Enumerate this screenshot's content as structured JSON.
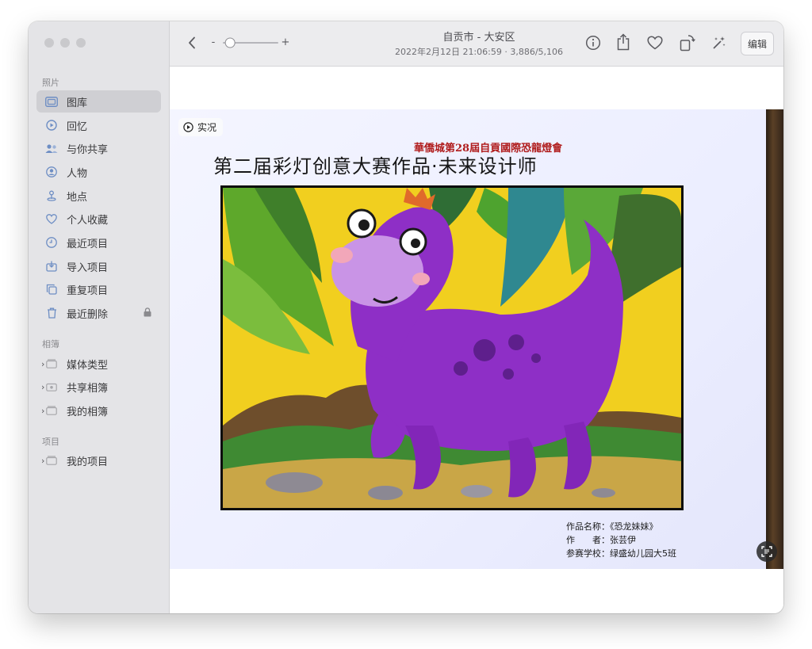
{
  "sidebar": {
    "sections": [
      {
        "label": "照片"
      },
      {
        "label": "相簿"
      },
      {
        "label": "项目"
      }
    ],
    "photos_items": [
      {
        "label": "图库",
        "icon": "photo-library-icon"
      },
      {
        "label": "回忆",
        "icon": "memories-icon"
      },
      {
        "label": "与你共享",
        "icon": "shared-with-you-icon"
      },
      {
        "label": "人物",
        "icon": "people-icon"
      },
      {
        "label": "地点",
        "icon": "places-icon"
      },
      {
        "label": "个人收藏",
        "icon": "heart-icon"
      },
      {
        "label": "最近项目",
        "icon": "clock-icon"
      },
      {
        "label": "导入项目",
        "icon": "import-icon"
      },
      {
        "label": "重复项目",
        "icon": "duplicates-icon"
      },
      {
        "label": "最近删除",
        "icon": "trash-icon"
      }
    ],
    "album_groups": [
      {
        "label": "媒体类型"
      },
      {
        "label": "共享相簿"
      },
      {
        "label": "我的相簿"
      }
    ],
    "project_groups": [
      {
        "label": "我的项目"
      }
    ]
  },
  "toolbar": {
    "title": "自贡市 - 大安区",
    "subtitle": "2022年2月12日 21:06:59  ·  3,886/5,106",
    "zoom_minus": "-",
    "zoom_plus": "+",
    "zoom_level": 0.12,
    "edit_label": "编辑"
  },
  "photo": {
    "live_label": "实况",
    "red_title": "華僑城第28屆自貢國際恐龍燈會",
    "main_title": "第二届彩灯创意大赛作品·未来设计师",
    "caption": [
      "作品名称：《恐龙妹妹》",
      "作　　者：张芸伊",
      "参赛学校：绿盛幼儿园大5班"
    ]
  },
  "colors": {
    "sidebar_bg": "#e4e4e7",
    "selected_bg": "#cfcfd3",
    "accent_icon": "#6e8ec4",
    "dino_purple": "#8e2fc6",
    "background_yellow": "#f2d21a"
  }
}
